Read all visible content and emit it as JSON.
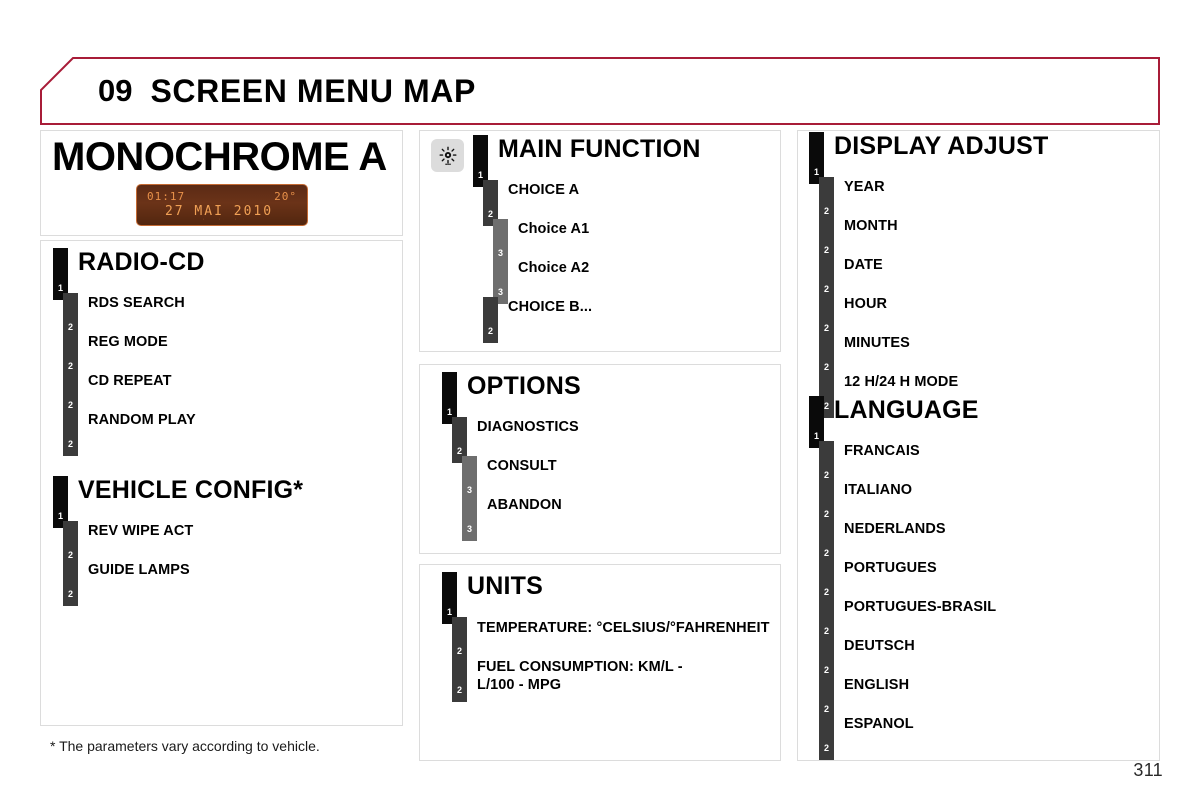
{
  "header": {
    "chapter_number": "09",
    "title": "SCREEN MENU MAP",
    "accent_color": "#a81c38"
  },
  "monochrome": {
    "title": "MONOCHROME A",
    "display": {
      "clock": "01:17",
      "temperature": "20°",
      "date": "27 MAI 2010",
      "indicators": "· · ·",
      "screen_color": "#6b3318",
      "text_color": "#e8914a"
    }
  },
  "menus": {
    "radio_cd": {
      "title": "RADIO-CD",
      "items": [
        {
          "label": "RDS SEARCH",
          "level": 2
        },
        {
          "label": "REG MODE",
          "level": 2
        },
        {
          "label": "CD REPEAT",
          "level": 2
        },
        {
          "label": "RANDOM PLAY",
          "level": 2
        }
      ]
    },
    "vehicle_config": {
      "title": "VEHICLE CONFIG*",
      "items": [
        {
          "label": "REV WIPE ACT",
          "level": 2
        },
        {
          "label": "GUIDE LAMPS",
          "level": 2
        }
      ]
    },
    "main_function": {
      "icon": "brightness-sun-icon",
      "title": "MAIN FUNCTION",
      "items": [
        {
          "label": "CHOICE A",
          "level": 2
        },
        {
          "label": "Choice A1",
          "level": 3
        },
        {
          "label": "Choice A2",
          "level": 3
        },
        {
          "label": "CHOICE B...",
          "level": 2
        }
      ]
    },
    "options": {
      "title": "OPTIONS",
      "items": [
        {
          "label": "DIAGNOSTICS",
          "level": 2
        },
        {
          "label": "CONSULT",
          "level": 3
        },
        {
          "label": "ABANDON",
          "level": 3
        }
      ]
    },
    "units": {
      "title": "UNITS",
      "items": [
        {
          "label": "TEMPERATURE: °CELSIUS/°FAHRENHEIT",
          "level": 2
        },
        {
          "label": "FUEL CONSUMPTION: KM/L - L/100 - MPG",
          "level": 2
        }
      ]
    },
    "display_adjust": {
      "title": "DISPLAY ADJUST",
      "items": [
        {
          "label": "YEAR",
          "level": 2
        },
        {
          "label": "MONTH",
          "level": 2
        },
        {
          "label": "DATE",
          "level": 2
        },
        {
          "label": "HOUR",
          "level": 2
        },
        {
          "label": "MINUTES",
          "level": 2
        },
        {
          "label": "12 H/24 H MODE",
          "level": 2
        }
      ]
    },
    "language": {
      "title": "LANGUAGE",
      "items": [
        {
          "label": "FRANCAIS",
          "level": 2
        },
        {
          "label": "ITALIANO",
          "level": 2
        },
        {
          "label": "NEDERLANDS",
          "level": 2
        },
        {
          "label": "PORTUGUES",
          "level": 2
        },
        {
          "label": "PORTUGUES-BRASIL",
          "level": 2
        },
        {
          "label": "DEUTSCH",
          "level": 2
        },
        {
          "label": "ENGLISH",
          "level": 2
        },
        {
          "label": "ESPANOL",
          "level": 2
        }
      ]
    }
  },
  "level_markers": {
    "one": "1",
    "two": "2",
    "three": "3"
  },
  "footnote": "* The parameters vary according to vehicle.",
  "page_number": "311"
}
